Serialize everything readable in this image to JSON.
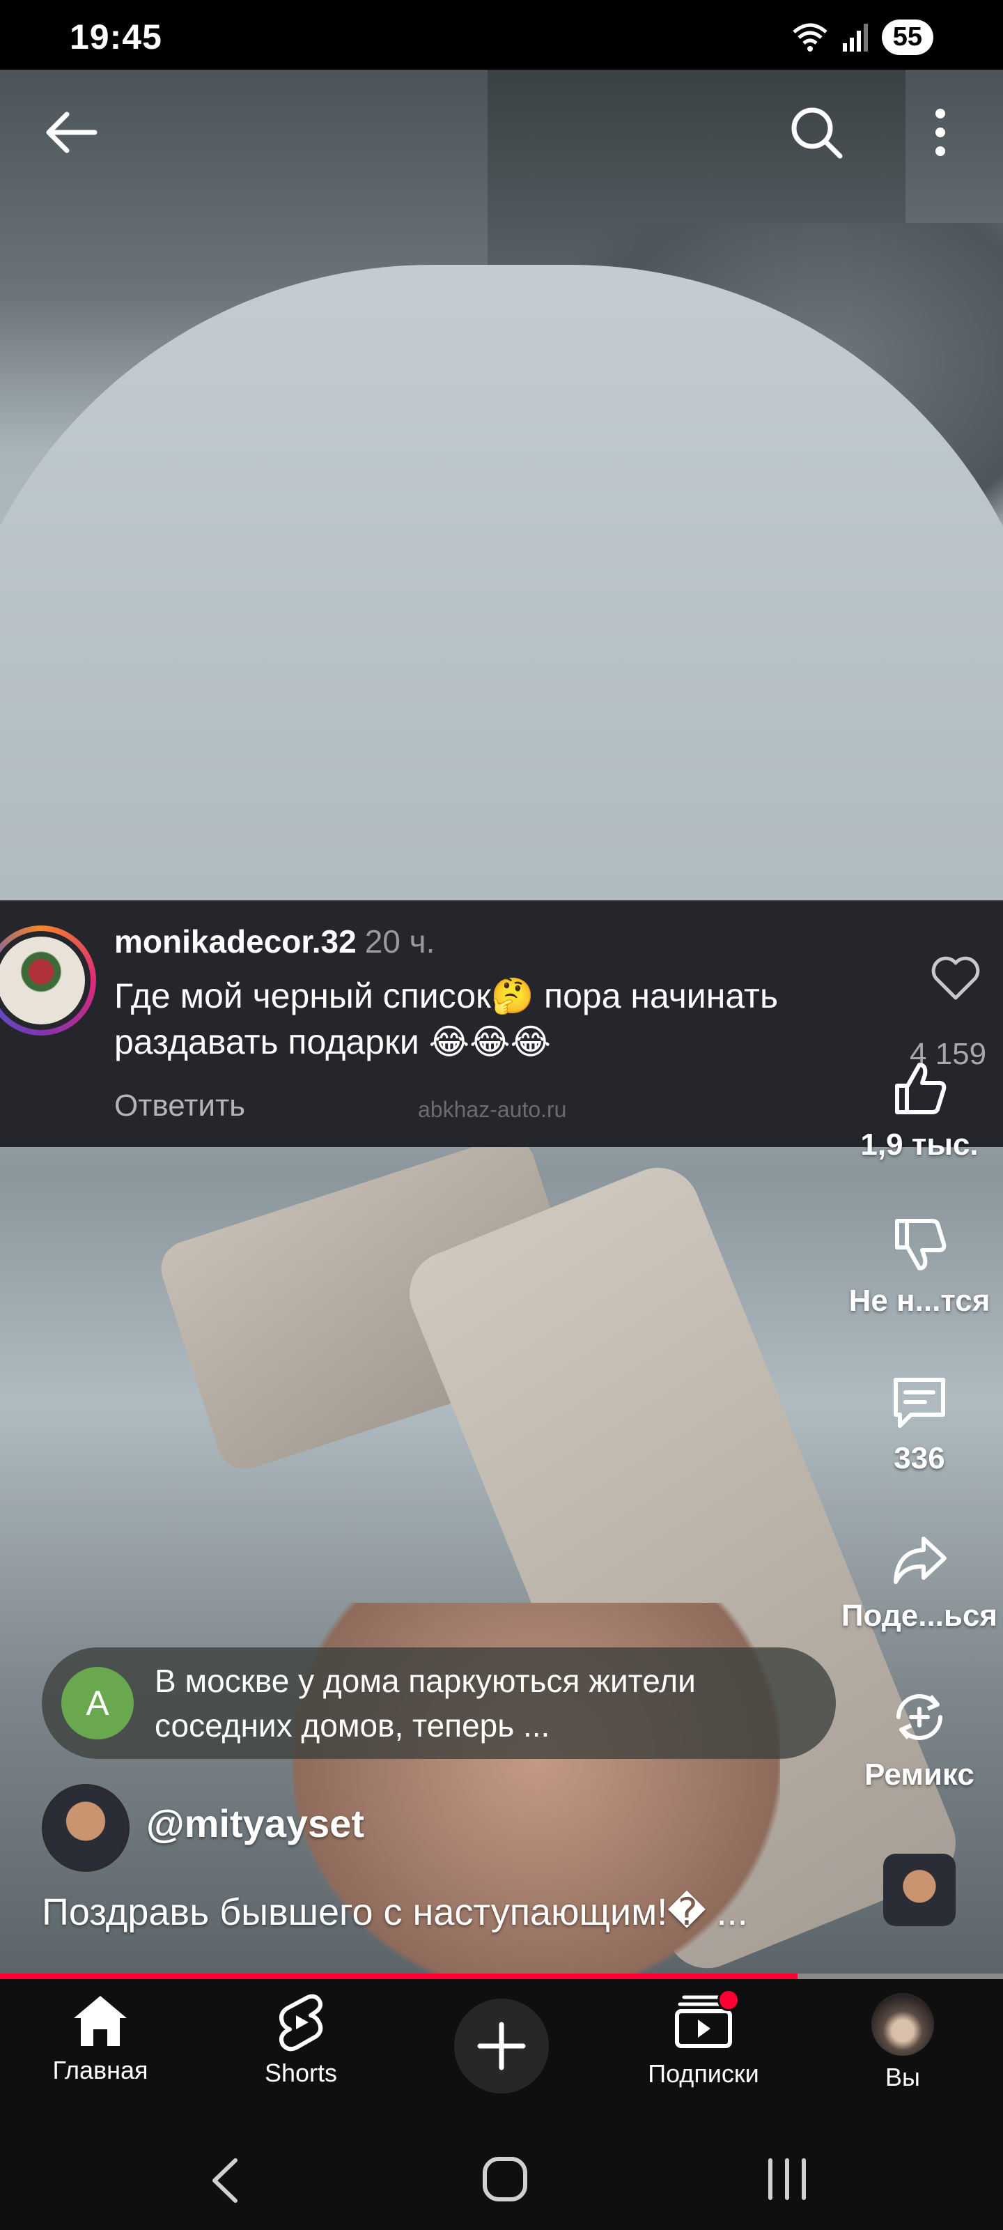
{
  "status_bar": {
    "time": "19:45",
    "battery": "55"
  },
  "comment": {
    "username": "monikadecor.32",
    "time_ago": "20 ч.",
    "text": "Где мой черный список🤔 пора начинать раздавать  подарки 😂😂😂",
    "reply_label": "Ответить",
    "like_count": "4 159",
    "watermark": "abkhaz-auto.ru"
  },
  "actions": {
    "like_count": "1,9 тыс.",
    "dislike_label": "Не н...тся",
    "comments_count": "336",
    "share_label": "Поде...ься",
    "remix_label": "Ремикс"
  },
  "suggestion": {
    "avatar_letter": "A",
    "text": "В москве у дома паркуються жители соседних домов, теперь ..."
  },
  "channel": {
    "handle": "@mityayset"
  },
  "video_title": "Поздравь бывшего с наступающим!� ...",
  "progress": 0.795,
  "nav": {
    "home": "Главная",
    "shorts": "Shorts",
    "subscriptions": "Подписки",
    "you": "Вы"
  },
  "colors": {
    "accent": "#ff0033",
    "background": "#0f0f0f",
    "comment_bg": "#24262b"
  }
}
